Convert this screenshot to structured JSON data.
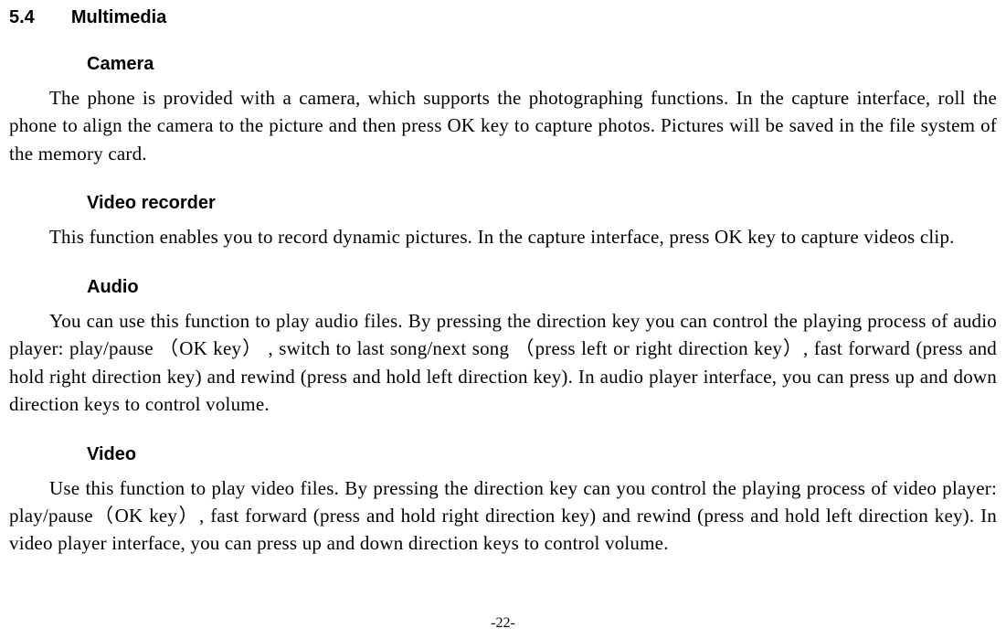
{
  "section": {
    "number": "5.4",
    "title": "Multimedia"
  },
  "subsections": {
    "camera": {
      "heading": "Camera",
      "body": "The phone is provided with a camera, which supports the photographing functions. In the capture interface, roll the phone to align the camera to the picture and then press OK key to capture photos. Pictures will be saved in the file system of the memory card."
    },
    "video_recorder": {
      "heading": "Video recorder",
      "body": "This function enables you to record dynamic pictures. In the capture interface, press OK key to capture videos clip."
    },
    "audio": {
      "heading": "Audio",
      "body": "You can use this function to play audio files. By pressing the direction key you can control the playing process of audio player: play/pause （OK key） , switch to last song/next song   （press left or right direction key）, fast forward (press and hold right direction key) and rewind (press and hold left direction key). In audio player interface, you can press up and down direction keys to control volume."
    },
    "video": {
      "heading": "Video",
      "body": "Use this function to play video files. By pressing the direction key can you control the playing process of video player: play/pause（OK key）, fast forward (press and hold right direction key) and rewind (press and hold left direction key). In video player interface, you can press up and down direction keys to control volume."
    }
  },
  "page_number": "-22-"
}
